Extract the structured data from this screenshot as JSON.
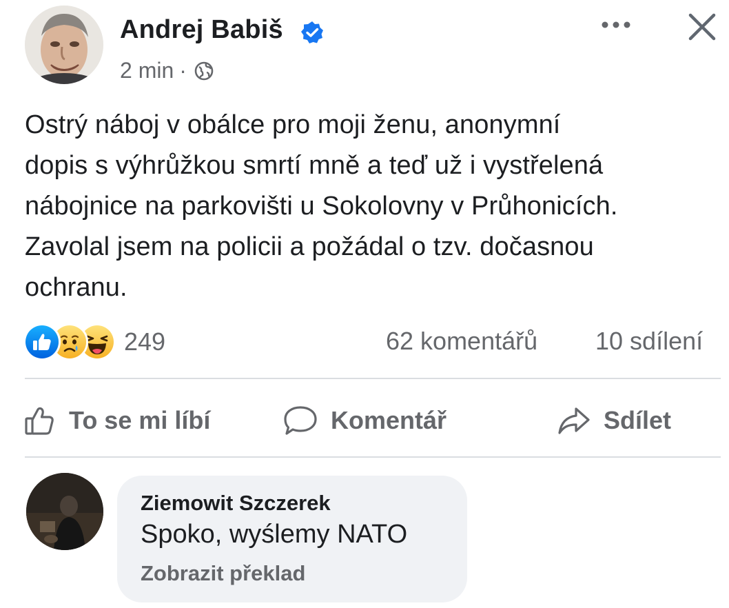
{
  "post": {
    "author": "Andrej Babiš",
    "verified": true,
    "time": "2 min",
    "separator": "·",
    "audience_icon": "globe-icon",
    "text_lines": [
      "Ostrý náboj v obálce pro moji ženu, anonymní",
      "dopis s výhrůžkou smrtí mně a teď už i vystřelená",
      "nábojnice na parkovišti u Sokolovny v Průhonicích.",
      "Zavolal jsem na policii a požádal o tzv. dočasnou",
      "ochranu."
    ]
  },
  "stats": {
    "reaction_icons": [
      "like-icon",
      "sad-icon",
      "haha-icon"
    ],
    "reaction_count": "249",
    "comments": "62 komentářů",
    "shares": "10 sdílení"
  },
  "actions": {
    "like": "To se mi líbí",
    "comment": "Komentář",
    "share": "Sdílet"
  },
  "comment": {
    "author": "Ziemowit Szczerek",
    "text": "Spoko, wyślemy NATO",
    "translate": "Zobrazit překlad"
  },
  "colors": {
    "text": "#1c1e21",
    "secondary": "#65676b",
    "verified_blue": "#1877f2",
    "bubble_bg": "#f0f2f5",
    "divider": "#dadde1"
  }
}
